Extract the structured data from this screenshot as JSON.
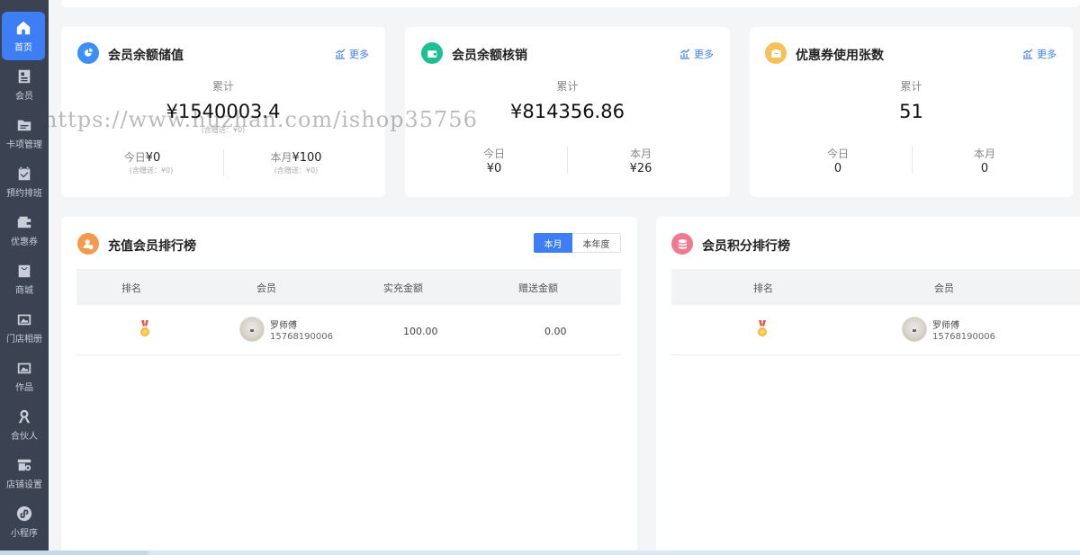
{
  "sidebar": {
    "items": [
      {
        "label": "首页",
        "icon": "home-icon"
      },
      {
        "label": "会员",
        "icon": "member-card-icon"
      },
      {
        "label": "卡项管理",
        "icon": "folder-icon"
      },
      {
        "label": "预约排班",
        "icon": "calendar-icon"
      },
      {
        "label": "优惠券",
        "icon": "wallet-icon"
      },
      {
        "label": "商城",
        "icon": "bag-icon"
      },
      {
        "label": "门店相册",
        "icon": "image-icon"
      },
      {
        "label": "作品",
        "icon": "image-icon"
      },
      {
        "label": "合伙人",
        "icon": "partner-icon"
      },
      {
        "label": "店铺设置",
        "icon": "store-settings-icon"
      },
      {
        "label": "小程序",
        "icon": "miniapp-icon"
      }
    ]
  },
  "more_label": "更多",
  "stats": {
    "recharge": {
      "title": "会员余额储值",
      "total_label": "累计",
      "total_value": "¥1540003.4",
      "total_note": "(含赠送：¥0)",
      "today_label": "今日",
      "today_value": "¥0",
      "today_note": "(含赠送：¥0)",
      "month_label": "本月",
      "month_value": "¥100",
      "month_note": "(含赠送：¥0)"
    },
    "writeoff": {
      "title": "会员余额核销",
      "total_label": "累计",
      "total_value": "¥814356.86",
      "today_label": "今日",
      "today_value": "¥0",
      "month_label": "本月",
      "month_value": "¥26"
    },
    "coupons": {
      "title": "优惠券使用张数",
      "total_label": "累计",
      "total_value": "51",
      "today_label": "今日",
      "today_value": "0",
      "month_label": "本月",
      "month_value": "0"
    }
  },
  "recharge_rank": {
    "title": "充值会员排行榜",
    "tabs": [
      "本月",
      "本年度"
    ],
    "columns": [
      "排名",
      "会员",
      "实充金额",
      "赠送金额"
    ],
    "rows": [
      {
        "name": "罗师傅",
        "phone": "15768190006",
        "paid": "100.00",
        "bonus": "0.00"
      }
    ]
  },
  "points_rank": {
    "title": "会员积分排行榜",
    "columns": [
      "排名",
      "会员"
    ],
    "rows": [
      {
        "name": "罗师傅",
        "phone": "15768190006"
      }
    ]
  },
  "watermark": "https://www.huzhan.com/ishop35756",
  "colors": {
    "accent": "#3d7ef5",
    "sidebar_bg": "#3b4252",
    "icon_blue": "#3d8ff5",
    "icon_teal": "#1fbf96",
    "icon_yellow": "#f6c15a",
    "icon_orange": "#f59a4a",
    "icon_pink": "#f07a8f"
  }
}
